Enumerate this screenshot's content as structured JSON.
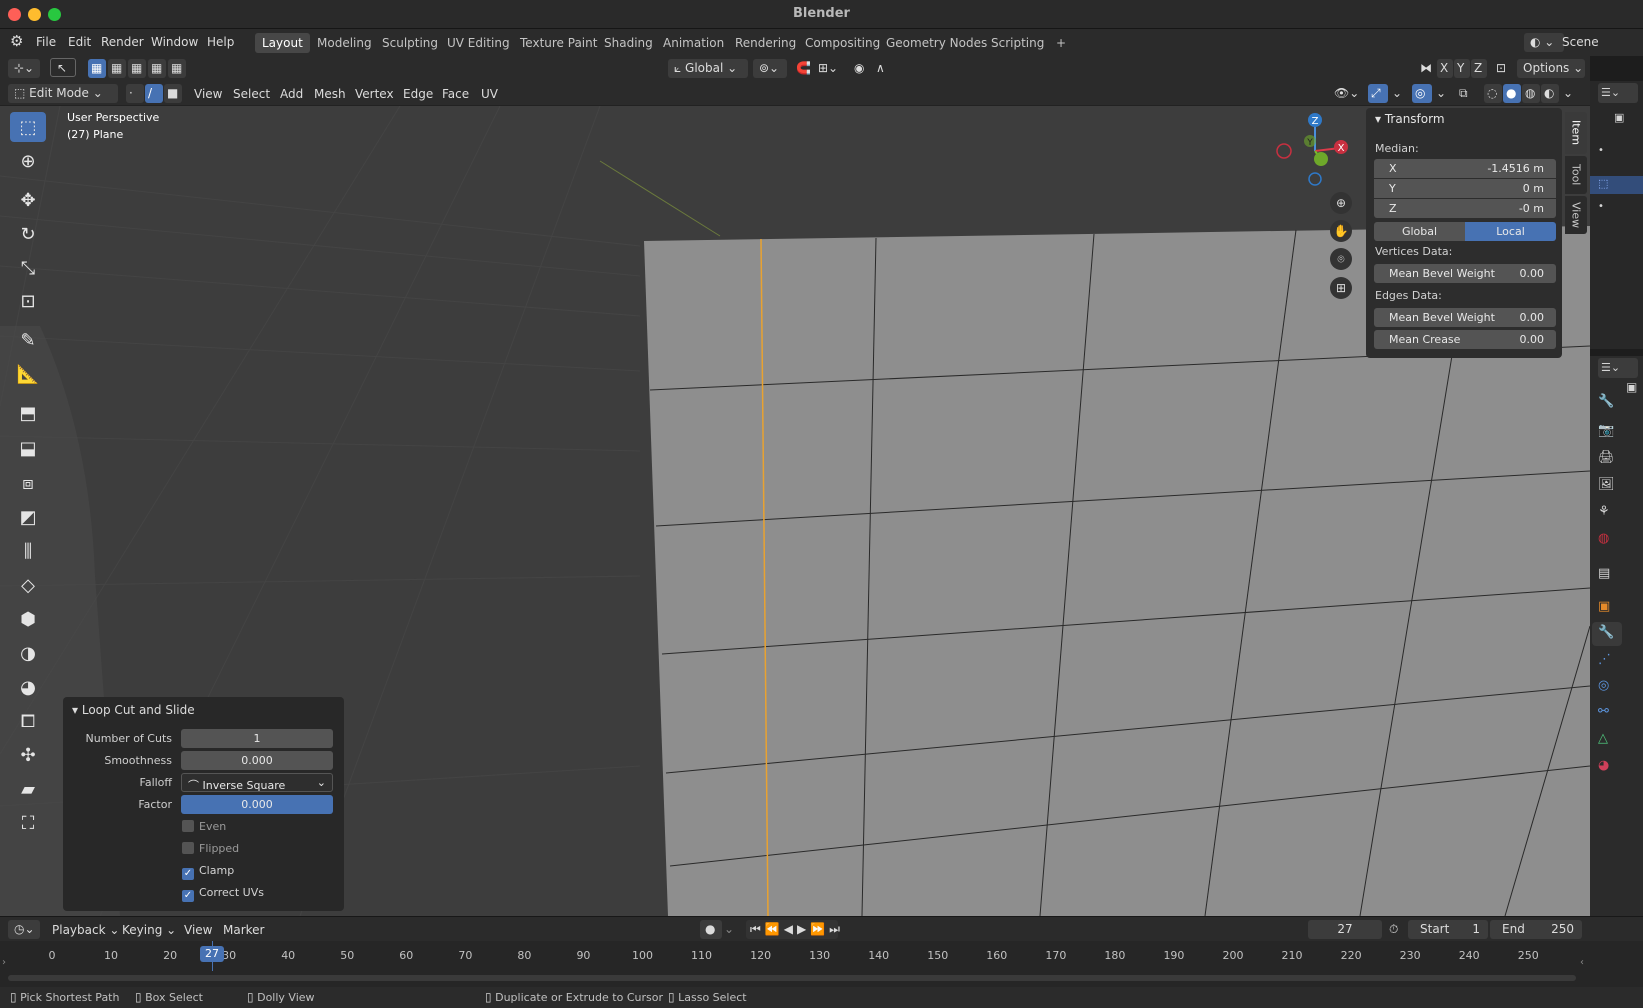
{
  "app": {
    "title": "Blender"
  },
  "menu": {
    "items": [
      "File",
      "Edit",
      "Render",
      "Window",
      "Help"
    ]
  },
  "workspaces": [
    "Layout",
    "Modeling",
    "Sculpting",
    "UV Editing",
    "Texture Paint",
    "Shading",
    "Animation",
    "Rendering",
    "Compositing",
    "Geometry Nodes",
    "Scripting"
  ],
  "active_workspace": "Layout",
  "scene": {
    "label": "Scene"
  },
  "tool_header": {
    "orientation": "Global",
    "options": "Options",
    "axes": [
      "X",
      "Y",
      "Z"
    ]
  },
  "mode_header": {
    "mode": "Edit Mode",
    "menus": [
      "View",
      "Select",
      "Add",
      "Mesh",
      "Vertex",
      "Edge",
      "Face",
      "UV"
    ]
  },
  "viewport": {
    "perspective": "User Perspective",
    "object": "(27) Plane"
  },
  "gizmo": {
    "axes": [
      "Z",
      "Y",
      "X"
    ]
  },
  "transform_panel": {
    "title": "Transform",
    "median_label": "Median:",
    "x": {
      "label": "X",
      "value": "-1.4516 m"
    },
    "y": {
      "label": "Y",
      "value": "0 m"
    },
    "z": {
      "label": "Z",
      "value": "-0 m"
    },
    "global": "Global",
    "local": "Local",
    "vertices_label": "Vertices Data:",
    "vert_bevel": {
      "label": "Mean Bevel Weight",
      "value": "0.00"
    },
    "edges_label": "Edges Data:",
    "edge_bevel": {
      "label": "Mean Bevel Weight",
      "value": "0.00"
    },
    "edge_crease": {
      "label": "Mean Crease",
      "value": "0.00"
    }
  },
  "side_tabs": [
    "Item",
    "Tool",
    "View"
  ],
  "operator_panel": {
    "title": "Loop Cut and Slide",
    "cuts": {
      "label": "Number of Cuts",
      "value": "1"
    },
    "smoothness": {
      "label": "Smoothness",
      "value": "0.000"
    },
    "falloff": {
      "label": "Falloff",
      "value": "Inverse Square"
    },
    "factor": {
      "label": "Factor",
      "value": "0.000"
    },
    "even": {
      "label": "Even",
      "checked": false
    },
    "flipped": {
      "label": "Flipped",
      "checked": false
    },
    "clamp": {
      "label": "Clamp",
      "checked": true
    },
    "correct_uvs": {
      "label": "Correct UVs",
      "checked": true
    }
  },
  "timeline": {
    "menus": [
      "Playback",
      "Keying",
      "View",
      "Marker"
    ],
    "current_frame": "27",
    "start_label": "Start",
    "start": "1",
    "end_label": "End",
    "end": "250",
    "ticks": [
      "0",
      "10",
      "20",
      "30",
      "40",
      "50",
      "60",
      "70",
      "80",
      "90",
      "100",
      "110",
      "120",
      "130",
      "140",
      "150",
      "160",
      "170",
      "180",
      "190",
      "200",
      "210",
      "220",
      "230",
      "240",
      "250"
    ]
  },
  "statusbar": {
    "items": [
      "Pick Shortest Path",
      "Box Select",
      "Dolly View",
      "Duplicate or Extrude to Cursor",
      "Lasso Select"
    ]
  },
  "colors": {
    "accent": "#4772b3",
    "viewport_bg": "#3d3d3d",
    "mesh_face": "#8e8e8e",
    "edge_highlight": "#e8a231"
  }
}
